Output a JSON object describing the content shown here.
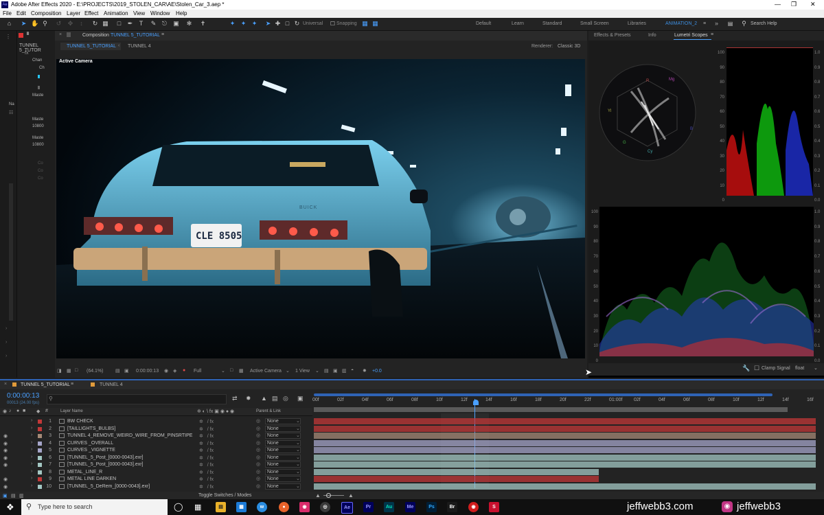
{
  "window": {
    "title": "Adobe After Effects 2020 - E:\\PROJECTS\\2019_STOLEN_CAR\\AE\\Stolen_Car_3.aep *",
    "app_badge": "Ae"
  },
  "menu": [
    "File",
    "Edit",
    "Composition",
    "Layer",
    "Effect",
    "Animation",
    "View",
    "Window",
    "Help"
  ],
  "toolbar": {
    "universal_label": "Universal",
    "snapping_label": "Snapping",
    "workspaces": [
      "Default",
      "Learn",
      "Standard",
      "Small Screen",
      "Libraries",
      "ANIMATION_2"
    ],
    "active_workspace": "ANIMATION_2",
    "search_placeholder": "Search Help"
  },
  "left_panel": {
    "title": "TUNNEL 5_TUTOR",
    "items": [
      "Chan",
      "Ch",
      "Maste",
      "Na",
      "Maste",
      "10800",
      "Maste",
      "10800",
      "Co",
      "Co",
      "Co"
    ]
  },
  "composition": {
    "panel_label": "Composition",
    "panel_name": "TUNNEL 5_TUTORIAL",
    "tabs": [
      "TUNNEL 5_TUTORIAL",
      "TUNNEL 4"
    ],
    "renderer_label": "Renderer:",
    "renderer_value": "Classic 3D",
    "camera_label": "Active Camera",
    "plate_text": "CLE 8505",
    "car_badge": "BUICK",
    "footer": {
      "zoom": "(64.1%)",
      "timecode": "0:00:00:13",
      "resolution": "Full",
      "camera": "Active Camera",
      "views": "1 View",
      "exposure": "+0.0"
    }
  },
  "right_panel": {
    "tabs": [
      "Effects & Presets",
      "Info",
      "Lumetri Scopes"
    ],
    "active_tab": "Lumetri Scopes",
    "vectorscope_labels": [
      "R",
      "Mg",
      "B",
      "Cy",
      "G",
      "Yl"
    ],
    "parade_scale_left": [
      "100",
      "90",
      "80",
      "70",
      "60",
      "50",
      "40",
      "30",
      "20",
      "10",
      "0"
    ],
    "parade_scale_right": [
      "1.0",
      "0.9",
      "0.8",
      "0.7",
      "0.6",
      "0.5",
      "0.4",
      "0.3",
      "0.2",
      "0.1",
      "0.0"
    ],
    "waveform_scale_left": [
      "100",
      "90",
      "80",
      "70",
      "60",
      "50",
      "40",
      "30",
      "20",
      "10",
      "0"
    ],
    "waveform_scale_right": [
      "1.0",
      "0.9",
      "0.8",
      "0.7",
      "0.6",
      "0.5",
      "0.4",
      "0.3",
      "0.2",
      "0.1",
      "0.0"
    ],
    "clamp_label": "Clamp Signal",
    "precision": "float"
  },
  "timeline": {
    "tabs": [
      "TUNNEL 5_TUTORIAL",
      "TUNNEL 4"
    ],
    "current_time": "0:00:00:13",
    "frames_info": "00013 (24.00 fps)",
    "ruler": [
      "00f",
      "02f",
      "04f",
      "06f",
      "08f",
      "10f",
      "12f",
      "14f",
      "16f",
      "18f",
      "20f",
      "22f",
      "01:00f",
      "02f",
      "04f",
      "06f",
      "08f",
      "10f",
      "12f",
      "14f",
      "16f"
    ],
    "col_layer_name": "Layer Name",
    "col_parent": "Parent & Link",
    "toggle_label": "Toggle Switches / Modes",
    "layers": [
      {
        "num": "1",
        "name": "BW CHECK",
        "parent": "None",
        "color": "#c13838"
      },
      {
        "num": "2",
        "name": "[TAILLIGHTS_BULBS]",
        "parent": "None",
        "color": "#c13838"
      },
      {
        "num": "3",
        "name": "TUNNEL 4_REMOVE_WEIRD_WIRE_FROM_PINSRTIPE",
        "parent": "None",
        "color": "#a58a77"
      },
      {
        "num": "4",
        "name": "CURVES _OVERALL",
        "parent": "None",
        "color": "#a5a5c9"
      },
      {
        "num": "5",
        "name": "CURVES _VIGNETTE",
        "parent": "None",
        "color": "#a5a5c9"
      },
      {
        "num": "6",
        "name": "[TUNNEL_5_Post_[0000-0043].exr]",
        "parent": "None",
        "color": "#a4c8c4"
      },
      {
        "num": "7",
        "name": "[TUNNEL_5_Post_[0000-0043].exr]",
        "parent": "None",
        "color": "#a4c8c4"
      },
      {
        "num": "8",
        "name": "METAL_LINE_R",
        "parent": "None",
        "color": "#a4c8c4"
      },
      {
        "num": "9",
        "name": "METAL LINE DARKEN",
        "parent": "None",
        "color": "#c13838"
      },
      {
        "num": "10",
        "name": "[TUNNEL_5_DeRem_[0000-0043].exr]",
        "parent": "None",
        "color": "#a4c8c4"
      }
    ]
  },
  "taskbar": {
    "search_placeholder": "Type here to search",
    "apps": [
      "Pr",
      "Au",
      "Me",
      "Ps",
      "Br"
    ],
    "watermark_site": "jeffwebb3.com",
    "watermark_handle": "jeffwebb3"
  }
}
